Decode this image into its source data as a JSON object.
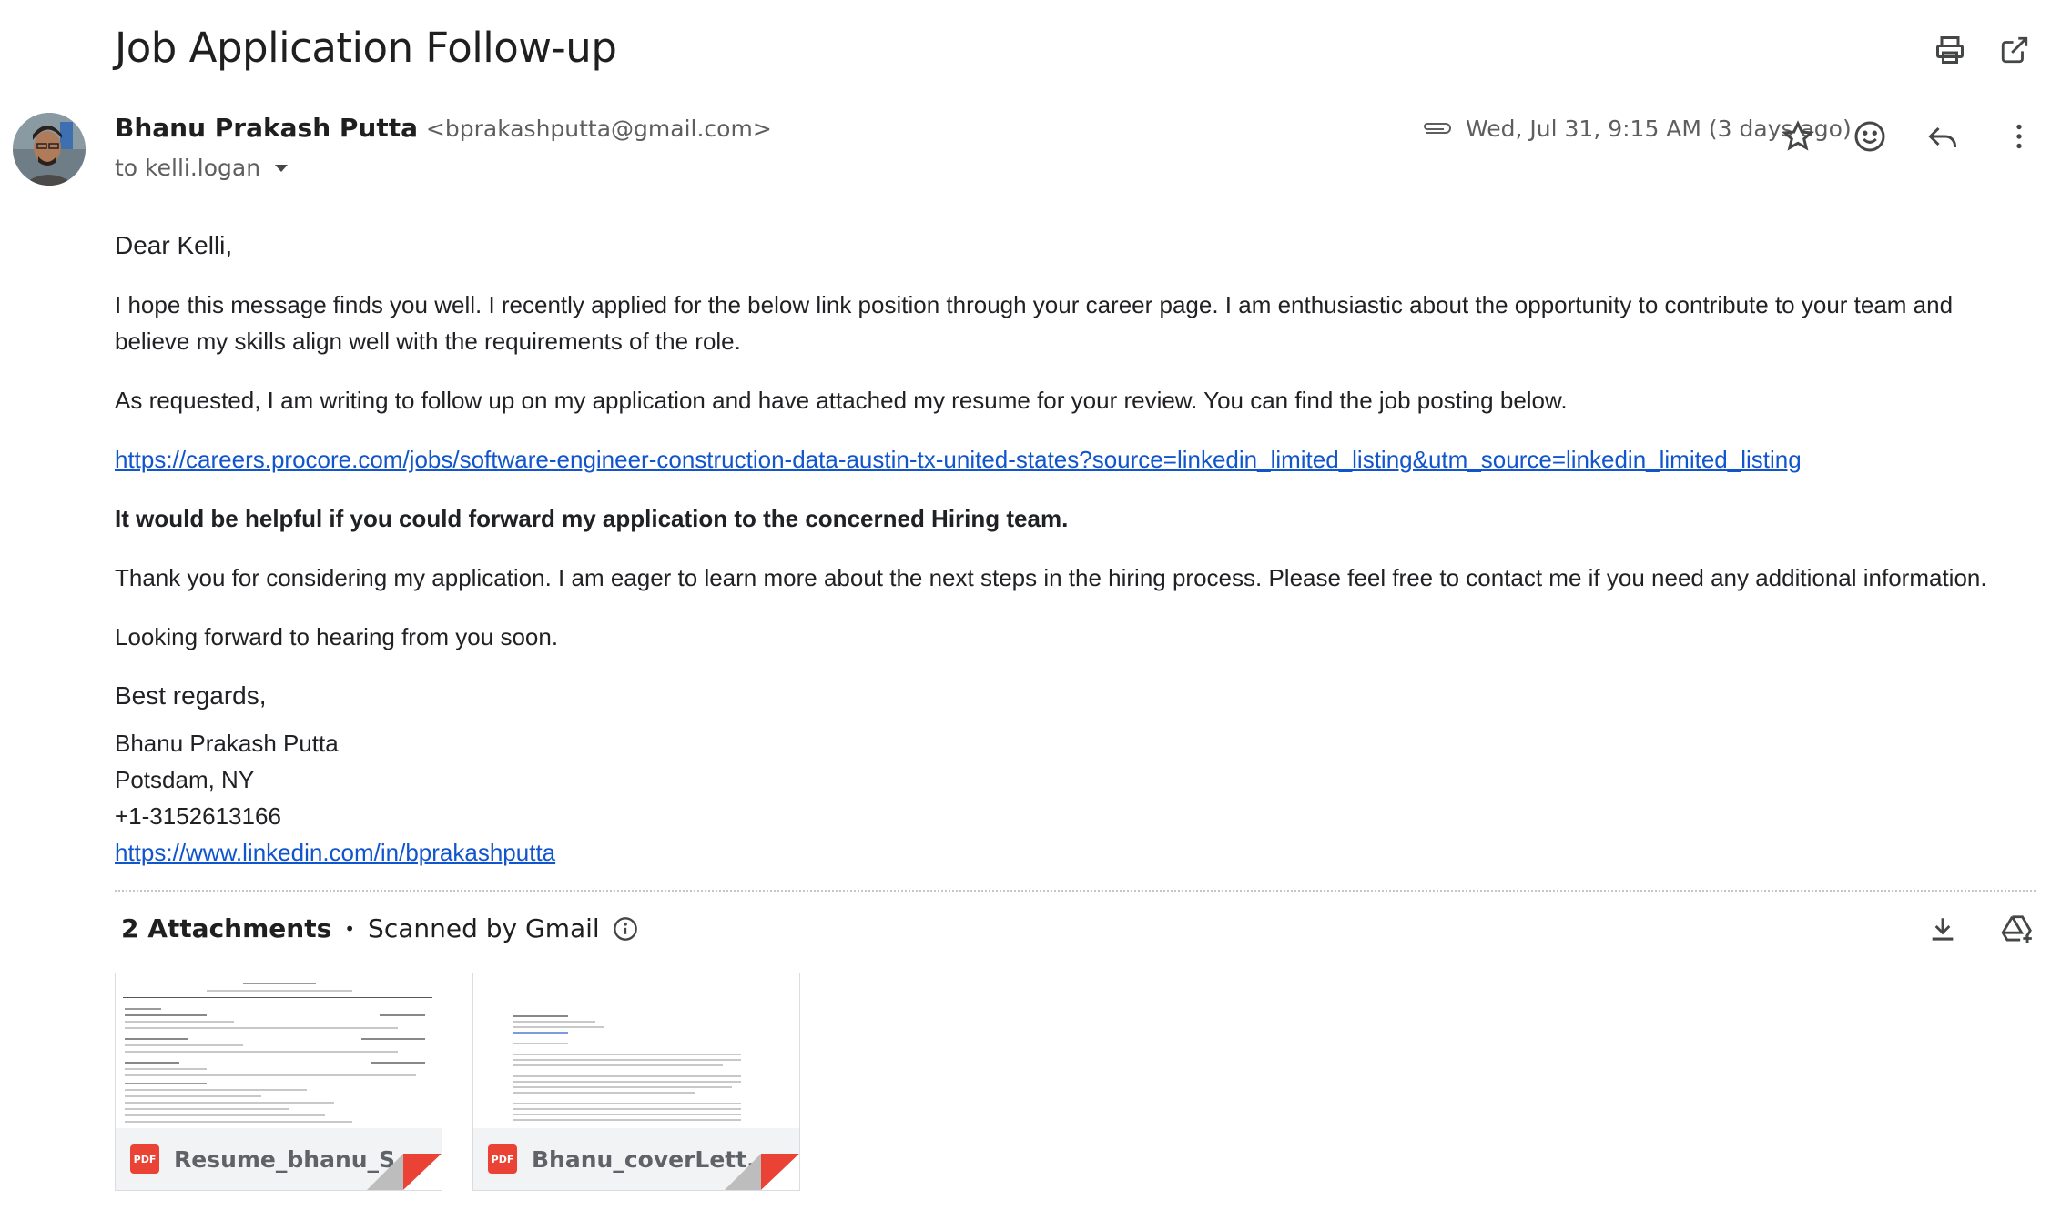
{
  "email": {
    "subject": "Job Application Follow-up",
    "sender_name": "Bhanu Prakash Putta",
    "sender_email": "<bprakashputta@gmail.com>",
    "recipient": "to kelli.logan",
    "date": "Wed, Jul 31, 9:15 AM (3 days ago)",
    "greeting": "Dear Kelli,",
    "para1": "I hope this message finds you well. I recently applied for the below link position through your career page. I am enthusiastic about the opportunity to contribute to your team and believe my skills align well with the requirements of the role.",
    "para2": "As requested, I am writing to follow up on my application and have attached my resume for your review. You can find the job posting below.",
    "job_link": "https://careers.procore.com/jobs/software-engineer-construction-data-austin-tx-united-states?source=linkedin_limited_listing&utm_source=linkedin_limited_listing",
    "bold_para": "It would be helpful if you could forward my application to the concerned Hiring team.",
    "para3": "Thank you for considering my application. I am eager to learn more about the next steps in the hiring process. Please feel free to contact me if you need any additional information.",
    "para4": "Looking forward to hearing from you soon.",
    "regards": "Best regards,",
    "sig_name": "Bhanu Prakash Putta",
    "sig_location": "Potsdam, NY",
    "sig_phone": "+1-3152613166",
    "sig_link": "https://www.linkedin.com/in/bprakashputta"
  },
  "attachments": {
    "count_label": "2 Attachments",
    "separator": "•",
    "scanned_label": "Scanned by Gmail",
    "files": [
      {
        "name": "Resume_bhanu_S...",
        "type": "PDF"
      },
      {
        "name": "Bhanu_coverLett...",
        "type": "PDF"
      }
    ]
  },
  "icons": {
    "print": "printer-icon",
    "open_new": "open-in-new-window-icon",
    "attachment": "paperclip-icon",
    "star": "star-icon",
    "emoji": "emoji-reaction-icon",
    "reply": "reply-icon",
    "more": "more-vert-icon",
    "download": "download-all-icon",
    "drive": "add-to-drive-icon",
    "info": "info-icon",
    "dropdown": "chevron-down-icon"
  },
  "colors": {
    "link": "#1155cc",
    "pdf_red": "#ea4335",
    "text": "#202124",
    "muted": "#5e5e5e"
  }
}
